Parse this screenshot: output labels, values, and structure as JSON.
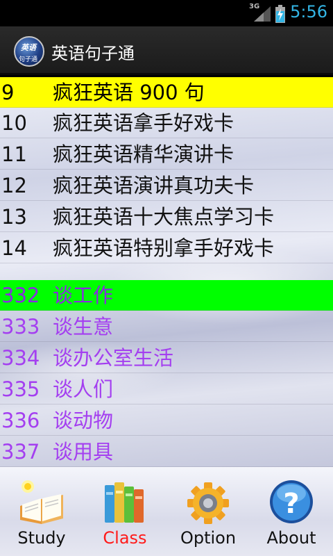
{
  "status_bar": {
    "network": "3G",
    "time": "5:56",
    "icons": [
      "signal-icon",
      "battery-charging-icon"
    ]
  },
  "app": {
    "title": "英语句子通",
    "icon_text_top": "英语",
    "icon_text_bottom": "句子通"
  },
  "list": {
    "items": [
      {
        "num": "9",
        "text": "疯狂英语 900 句",
        "style": "sel-yellow"
      },
      {
        "num": "10",
        "text": "疯狂英语拿手好戏卡",
        "style": "black"
      },
      {
        "num": "11",
        "text": "疯狂英语精华演讲卡",
        "style": "black"
      },
      {
        "num": "12",
        "text": "疯狂英语演讲真功夫卡",
        "style": "black"
      },
      {
        "num": "13",
        "text": "疯狂英语十大焦点学习卡",
        "style": "black"
      },
      {
        "num": "14",
        "text": "疯狂英语特别拿手好戏卡",
        "style": "black"
      },
      {
        "num": "332",
        "text": "谈工作",
        "style": "sel-green"
      },
      {
        "num": "333",
        "text": "谈生意",
        "style": "purple"
      },
      {
        "num": "334",
        "text": "谈办公室生活",
        "style": "purple"
      },
      {
        "num": "335",
        "text": "谈人们",
        "style": "purple"
      },
      {
        "num": "336",
        "text": "谈动物",
        "style": "purple"
      },
      {
        "num": "337",
        "text": "谈用具",
        "style": "purple"
      }
    ]
  },
  "tabs": [
    {
      "label": "Study",
      "icon": "open-book-icon",
      "active": false
    },
    {
      "label": "Class",
      "icon": "books-icon",
      "active": true
    },
    {
      "label": "Option",
      "icon": "gear-icon",
      "active": false
    },
    {
      "label": "About",
      "icon": "help-icon",
      "active": false
    }
  ],
  "colors": {
    "selected_top": "#ffff00",
    "selected_bottom": "#00ff00",
    "purple_text": "#a43ff0",
    "active_tab": "#ff1a1a",
    "clock": "#33b5e5"
  }
}
